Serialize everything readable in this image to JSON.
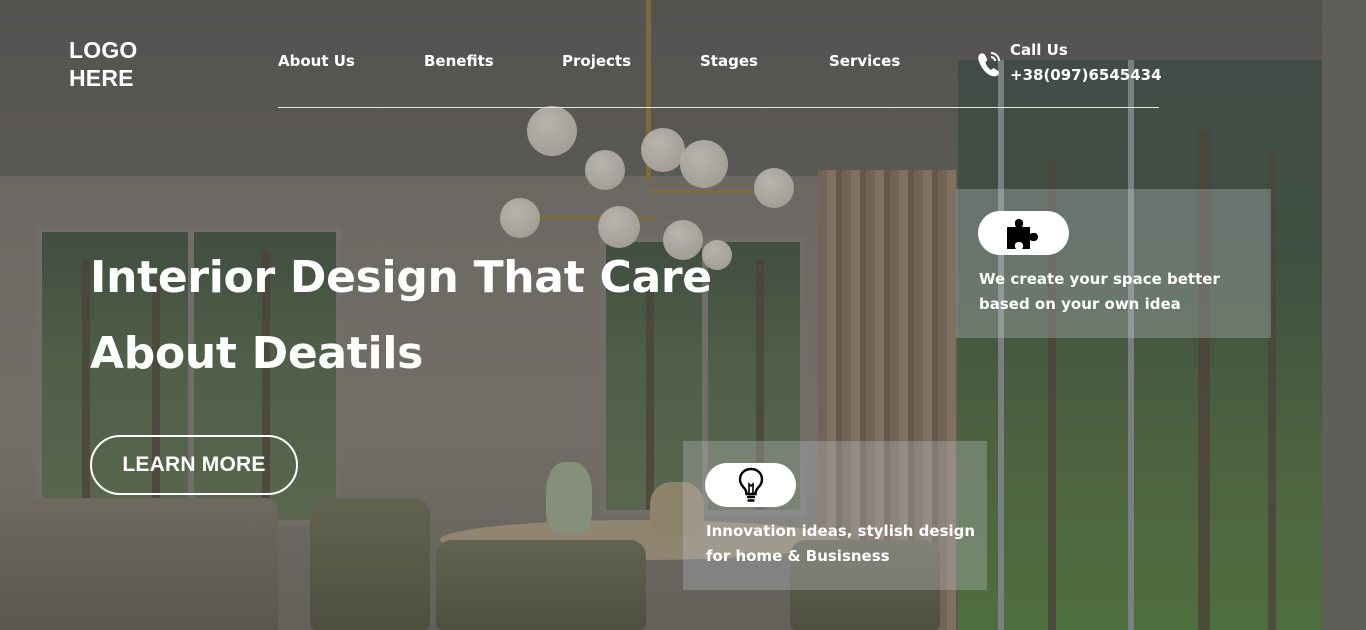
{
  "header": {
    "logo": "LOGO\nHERE",
    "nav": [
      {
        "label": "About Us"
      },
      {
        "label": "Benefits"
      },
      {
        "label": "Projects"
      },
      {
        "label": "Stages"
      },
      {
        "label": "Services"
      }
    ],
    "call": {
      "label": "Call Us",
      "number": "+38(097)6545434",
      "icon": "phone-ringing-icon"
    }
  },
  "hero": {
    "title_line1": "Interior Design That Care",
    "title_line2": "About Deatils",
    "cta_label": "LEARN MORE"
  },
  "features": [
    {
      "icon": "puzzle-icon",
      "text": "We create your space better based on your own idea"
    },
    {
      "icon": "lightbulb-icon",
      "text": "Innovation ideas, stylish design for home & Busisness"
    }
  ],
  "colors": {
    "text": "#ffffff",
    "card_bg": "rgba(200,203,208,0.30)",
    "icon_pill": "#ffffff",
    "icon": "#000000"
  }
}
